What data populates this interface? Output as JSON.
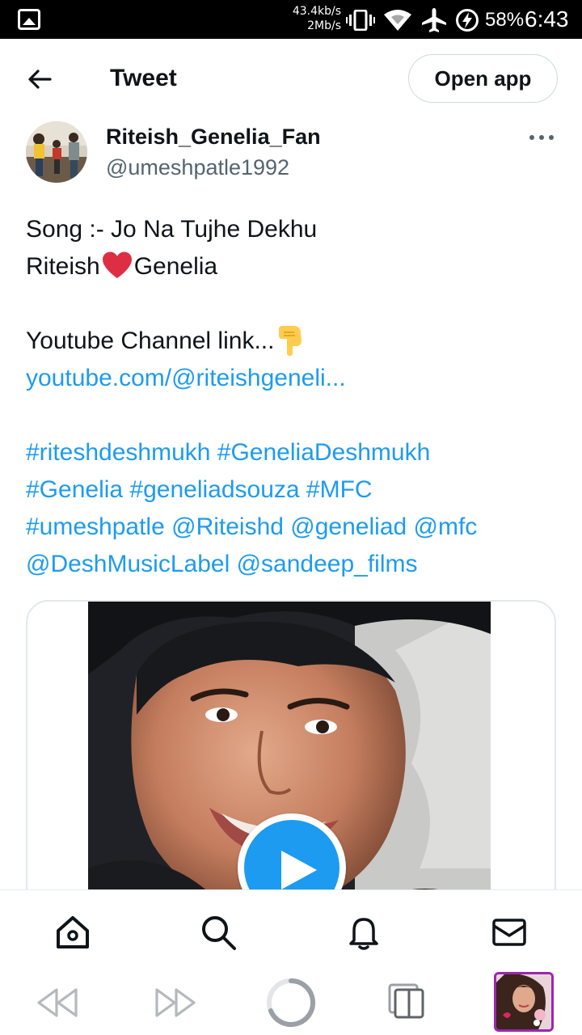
{
  "status_bar": {
    "speed_up": "43.4kb/s",
    "speed_down": "2Mb/s",
    "battery": "58%",
    "time": "6:43",
    "icons": [
      "gallery-icon",
      "vibrate-icon",
      "wifi-icon",
      "airplane-icon",
      "battery-saver-icon"
    ]
  },
  "header": {
    "title": "Tweet",
    "open_app_label": "Open app"
  },
  "author": {
    "name": "Riteish_Genelia_Fan",
    "handle": "@umeshpatle1992"
  },
  "tweet": {
    "line1": "Song :- Jo Na Tujhe Dekhu",
    "line2_a": "Riteish",
    "line2_b": "Genelia",
    "line3": "Youtube Channel link...",
    "link": "youtube.com/@riteishgeneli...",
    "tags_line1": "#riteshdeshmukh #GeneliaDeshmukh",
    "tags_line2": "#Genelia #geneliadsouza #MFC",
    "tags_line3": "#umeshpatle @Riteishd @geneliad @mfc",
    "tags_line4": "@DeshMusicLabel @sandeep_films"
  },
  "colors": {
    "accent": "#1d9bf0",
    "text": "#0f1419",
    "secondary": "#536471",
    "heart": "#e0245e"
  },
  "bottom_nav": [
    "home-icon",
    "search-icon",
    "notifications-icon",
    "messages-icon"
  ],
  "browser_nav": [
    "back-icon",
    "forward-icon",
    "loading-icon",
    "tabs-icon"
  ]
}
